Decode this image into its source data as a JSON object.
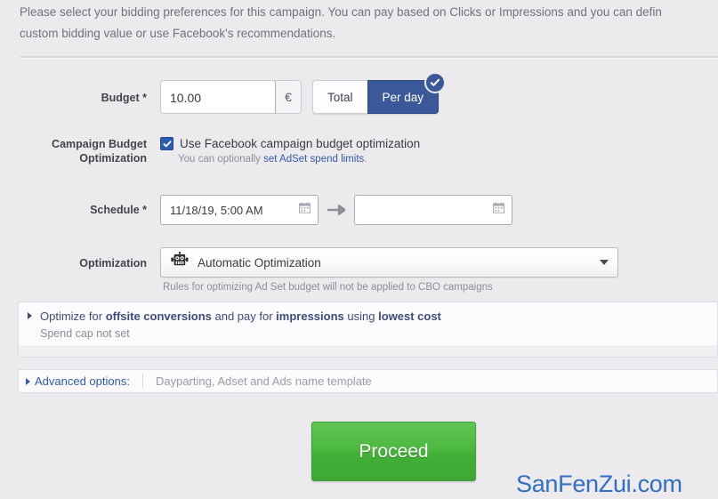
{
  "intro": {
    "text": "Please select your bidding preferences for this campaign. You can pay based on Clicks or Impressions and you can defin\ncustom bidding value or use Facebook's recommendations."
  },
  "form": {
    "budget": {
      "label": "Budget *",
      "value": "10.00",
      "placeholder": "0.00",
      "currency": "€",
      "toggle": {
        "total_label": "Total",
        "per_day_label": "Per day",
        "selected": "Per day",
        "selected_color": "#3b5998"
      }
    },
    "campaign_budget_optimization": {
      "label": "Campaign Budget\nOptimization",
      "checkbox_label": "Use Facebook campaign budget optimization",
      "checked": true,
      "sub_prefix": "You can optionally ",
      "sub_link": "set AdSet spend limits",
      "sub_suffix": ".",
      "link_color": "#2f5bad"
    },
    "schedule": {
      "label": "Schedule *",
      "start_value": "11/18/19, 5:00 AM",
      "start_placeholder": "",
      "end_value": "",
      "end_placeholder": "",
      "arrow_icon": "arrow-right-icon",
      "calendar_icon": "calendar-icon"
    },
    "optimization": {
      "label": "Optimization",
      "icon": "robot-icon",
      "selected": "Automatic Optimization",
      "caret_icon": "chevron-down-icon",
      "note": "Rules for optimizing Ad Set budget will not be applied to CBO campaigns"
    }
  },
  "optimize_panel": {
    "expander_icon": "triangle-right-icon",
    "text_part1": "Optimize for ",
    "bold1": "offsite conversions",
    "text_part2": " and pay for ",
    "bold2": "impressions",
    "text_part3": " using ",
    "bold3": "lowest cost",
    "sub": "Spend cap not set",
    "text_color": "#3b4c7c"
  },
  "advanced": {
    "expander_icon": "triangle-right-icon",
    "label": "Advanced options:",
    "description": "Dayparting, Adset and Ads name template"
  },
  "proceed": {
    "label": "Proceed",
    "color": "#4cb83f"
  },
  "watermark": {
    "text": "SanFenZui.com",
    "color": "#2f6fc6"
  }
}
